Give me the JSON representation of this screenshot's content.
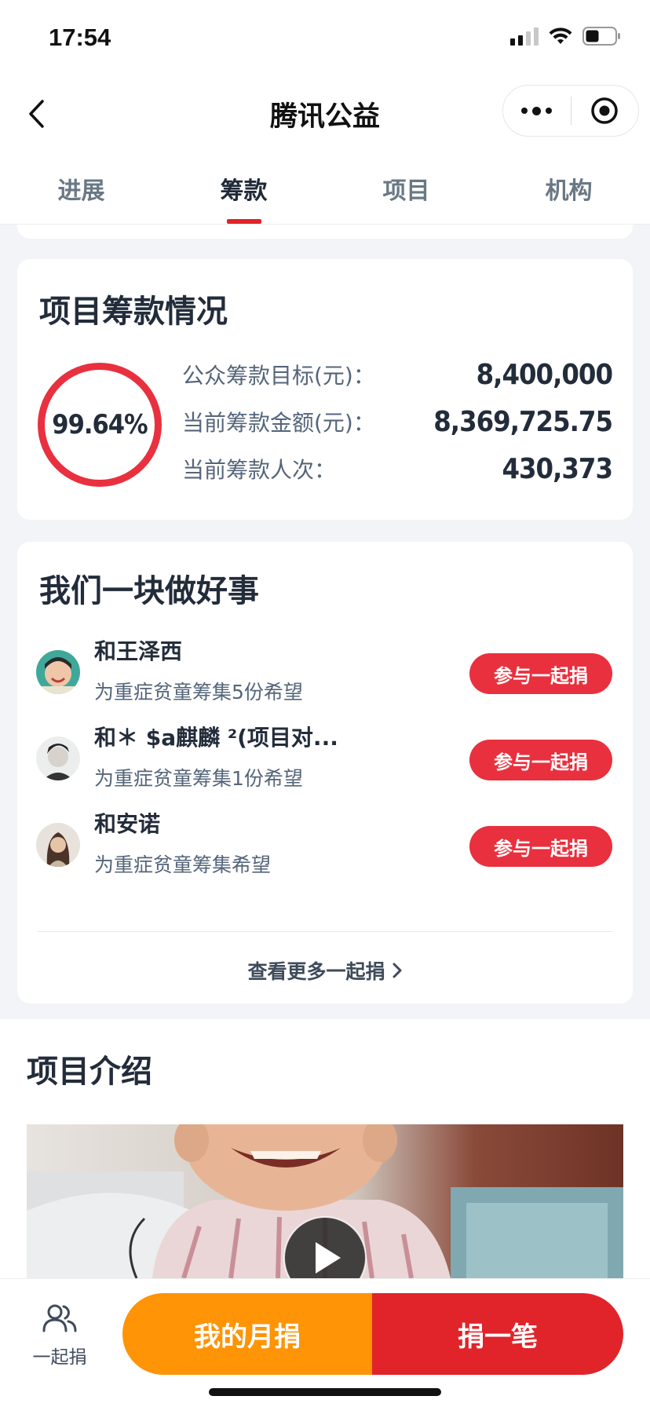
{
  "status_bar": {
    "time": "17:54"
  },
  "nav": {
    "title": "腾讯公益"
  },
  "tabs": [
    {
      "label": "进展"
    },
    {
      "label": "筹款",
      "active": true
    },
    {
      "label": "项目"
    },
    {
      "label": "机构"
    }
  ],
  "raise": {
    "title": "项目筹款情况",
    "percent": "99.64%",
    "stats": [
      {
        "label": "公众筹款目标(元)：",
        "value": "8,400,000"
      },
      {
        "label": "当前筹款金额(元)：",
        "value": "8,369,725.75"
      },
      {
        "label": "当前筹款人次：",
        "value": "430,373"
      }
    ]
  },
  "together": {
    "title": "我们一块做好事",
    "donors": [
      {
        "name": "和王泽西",
        "desc": "为重症贫童筹集5份希望",
        "button": "参与一起捐"
      },
      {
        "name": "和＊ $a麒麟 ²(项目对...",
        "desc": "为重症贫童筹集1份希望",
        "button": "参与一起捐"
      },
      {
        "name": "和安诺",
        "desc": "为重症贫童筹集希望",
        "button": "参与一起捐"
      }
    ],
    "more_link": "查看更多一起捐"
  },
  "intro": {
    "title": "项目介绍"
  },
  "bottom": {
    "together_label": "一起捐",
    "monthly_button": "我的月捐",
    "donate_button": "捐一笔"
  },
  "colors": {
    "accent_red": "#e9303e",
    "donate_red": "#e0242a",
    "monthly_orange": "#fe9406"
  }
}
